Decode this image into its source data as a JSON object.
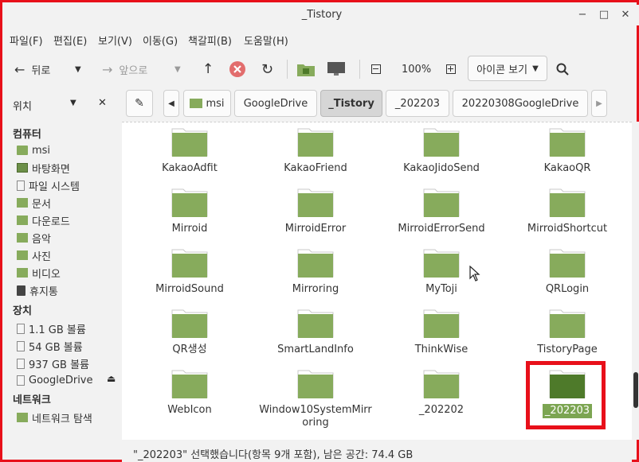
{
  "window": {
    "title": "_Tistory"
  },
  "menu": [
    "파일(F)",
    "편집(E)",
    "보기(V)",
    "이동(G)",
    "책갈피(B)",
    "도움말(H)"
  ],
  "toolbar": {
    "back": "뒤로",
    "forward": "앞으로",
    "zoom": "100%",
    "view_mode": "아이콘 보기"
  },
  "pathbar": [
    "msi",
    "GoogleDrive",
    "_Tistory",
    "_202203",
    "20220308GoogleDrive"
  ],
  "sidebar": {
    "header_label": "위치",
    "sections": [
      {
        "title": "컴퓨터",
        "items": [
          "msi",
          "바탕화면",
          "파일 시스템",
          "문서",
          "다운로드",
          "음악",
          "사진",
          "비디오",
          "휴지통"
        ]
      },
      {
        "title": "장치",
        "items": [
          "1.1 GB 볼륨",
          "54 GB 볼륨",
          "937 GB 볼륨",
          "GoogleDrive"
        ]
      },
      {
        "title": "네트워크",
        "items": [
          "네트워크 탐색"
        ]
      }
    ]
  },
  "folders": [
    [
      "KakaoAdfit",
      "KakaoFriend",
      "KakaoJidoSend",
      "KakaoQR"
    ],
    [
      "Mirroid",
      "MirroidError",
      "MirroidErrorSend",
      "MirroidShortcut"
    ],
    [
      "MirroidSound",
      "Mirroring",
      "MyToji",
      "QRLogin"
    ],
    [
      "QR생성",
      "SmartLandInfo",
      "ThinkWise",
      "TistoryPage"
    ],
    [
      "WebIcon",
      "Window10SystemMirr",
      "_202202",
      "_202203"
    ]
  ],
  "folder_wrap_extra": "oring",
  "selected_folder": "_202203",
  "status": "\"_202203\" 선택했습니다(항목 9개 포함), 남은 공간: 74.4 GB",
  "colors": {
    "folder": "#87ab5c",
    "folder_dark": "#4e7a2a",
    "highlight": "#e8101a"
  }
}
